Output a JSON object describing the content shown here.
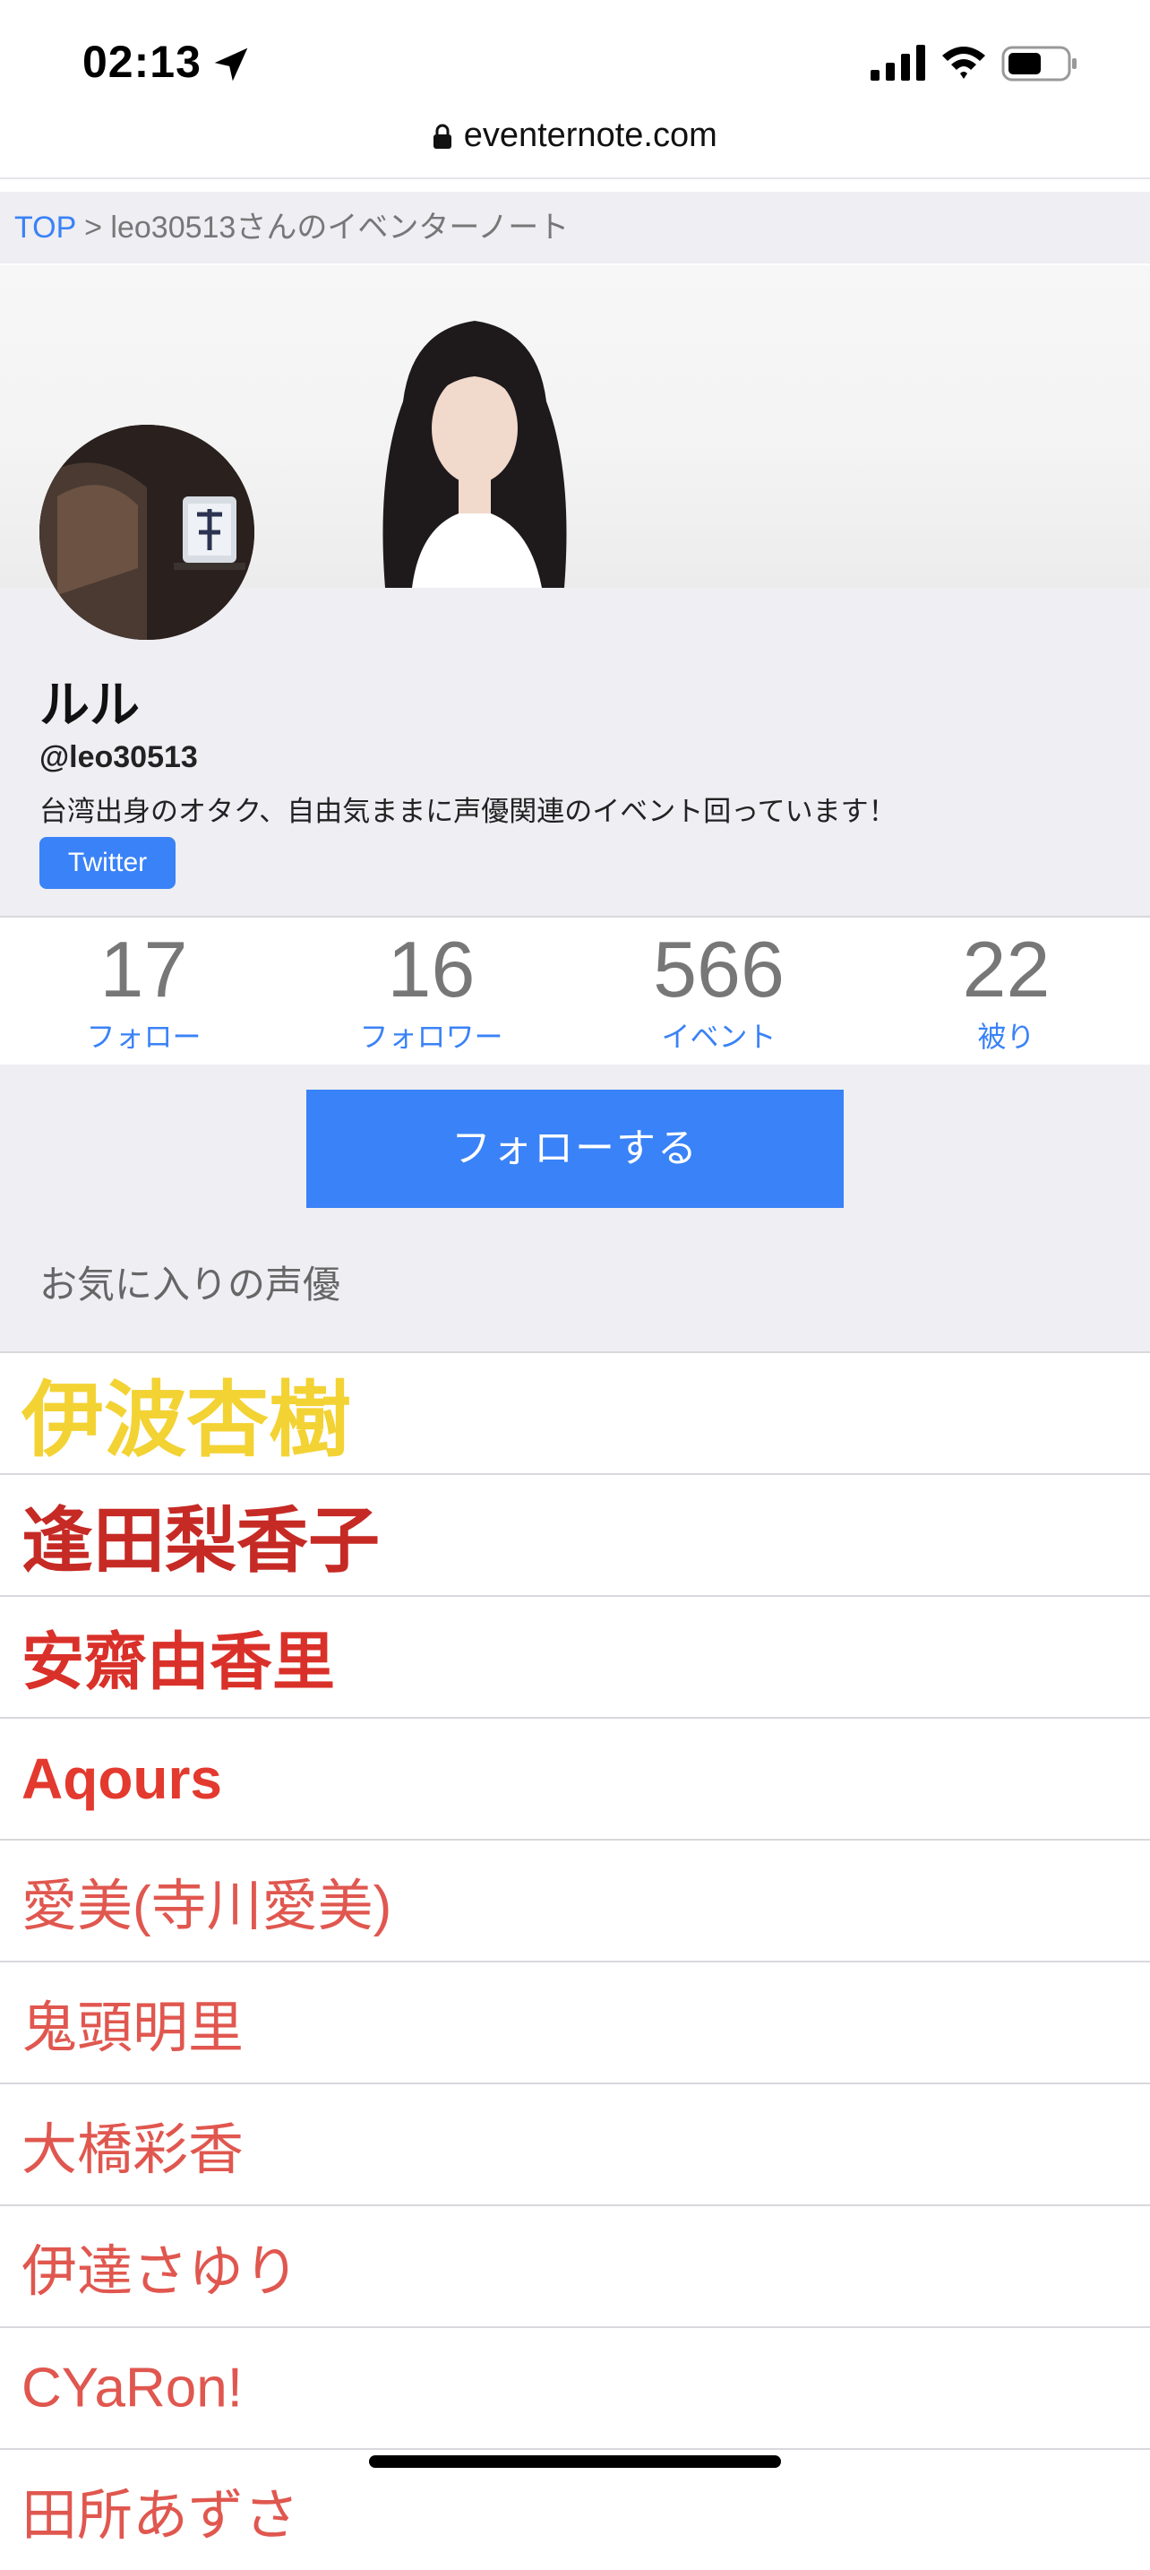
{
  "status_bar": {
    "time": "02:13"
  },
  "browser": {
    "url": "eventernote.com"
  },
  "breadcrumb": {
    "top": "TOP",
    "separator": " > ",
    "current": "leo30513さんのイベンターノート"
  },
  "profile": {
    "name": "ルル",
    "handle": "@leo30513",
    "bio": "台湾出身のオタク、自由気ままに声優関連のイベント回っています！",
    "twitter_label": "Twitter"
  },
  "stats": [
    {
      "number": "17",
      "label": "フォロー"
    },
    {
      "number": "16",
      "label": "フォロワー"
    },
    {
      "number": "566",
      "label": "イベント"
    },
    {
      "number": "22",
      "label": "被り"
    }
  ],
  "follow_button": "フォローする",
  "favorites_title": "お気に入りの声優",
  "favorites": [
    {
      "name": "伊波杏樹",
      "color": "#f3d233"
    },
    {
      "name": "逢田梨香子",
      "color": "#c62a25"
    },
    {
      "name": "安齋由香里",
      "color": "#d9312a"
    },
    {
      "name": "Aqours",
      "color": "#e3392e"
    },
    {
      "name": "愛美(寺川愛美)",
      "color": "#e0574f"
    },
    {
      "name": "鬼頭明里",
      "color": "#e0574f"
    },
    {
      "name": "大橋彩香",
      "color": "#e0574f"
    },
    {
      "name": "伊達さゆり",
      "color": "#e0574f"
    },
    {
      "name": "CYaRon!",
      "color": "#e0574f"
    },
    {
      "name": "田所あずさ",
      "color": "#e0574f"
    }
  ],
  "colors": {
    "accent": "#3a82f7",
    "panel": "#eeeef3"
  }
}
